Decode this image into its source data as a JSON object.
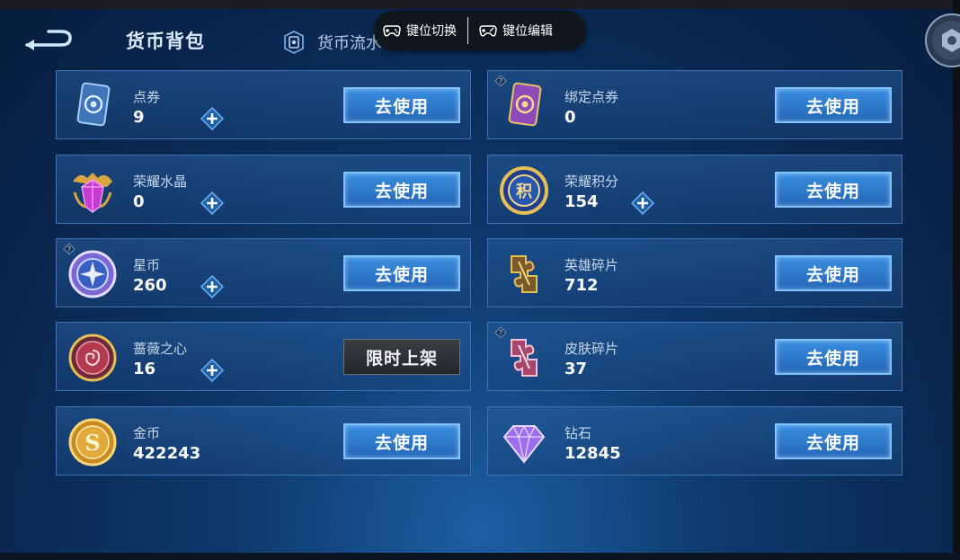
{
  "header": {
    "title": "货币背包",
    "tab_flow_label": "货币流水"
  },
  "overlay": {
    "switch_label": "键位切换",
    "edit_label": "键位编辑"
  },
  "cards": [
    {
      "name": "点券",
      "value": "9",
      "button": "去使用",
      "icon": "voucher-card-icon",
      "has_plus": true,
      "has_help": false
    },
    {
      "name": "绑定点券",
      "value": "0",
      "button": "去使用",
      "icon": "bound-voucher-card-icon",
      "has_plus": false,
      "has_help": true
    },
    {
      "name": "荣耀水晶",
      "value": "0",
      "button": "去使用",
      "icon": "glory-crystal-icon",
      "has_plus": true,
      "has_help": false
    },
    {
      "name": "荣耀积分",
      "value": "154",
      "button": "去使用",
      "icon": "glory-points-icon",
      "has_plus": true,
      "has_help": false
    },
    {
      "name": "星币",
      "value": "260",
      "button": "去使用",
      "icon": "star-coin-icon",
      "has_plus": true,
      "has_help": true
    },
    {
      "name": "英雄碎片",
      "value": "712",
      "button": "去使用",
      "icon": "hero-fragment-icon",
      "has_plus": false,
      "has_help": false
    },
    {
      "name": "蔷薇之心",
      "value": "16",
      "button": "限时上架",
      "icon": "rose-heart-icon",
      "has_plus": true,
      "has_help": false
    },
    {
      "name": "皮肤碎片",
      "value": "37",
      "button": "去使用",
      "icon": "skin-fragment-icon",
      "has_plus": false,
      "has_help": true
    },
    {
      "name": "金币",
      "value": "422243",
      "button": "去使用",
      "icon": "gold-coin-icon",
      "has_plus": false,
      "has_help": false
    },
    {
      "name": "钻石",
      "value": "12845",
      "button": "去使用",
      "icon": "diamond-icon",
      "has_plus": false,
      "has_help": false
    }
  ],
  "colors": {
    "accent": "#2f7bd0",
    "button_border": "#7fc3ff",
    "card_border": "#3d73b3",
    "limited_button": "#2c3035"
  }
}
